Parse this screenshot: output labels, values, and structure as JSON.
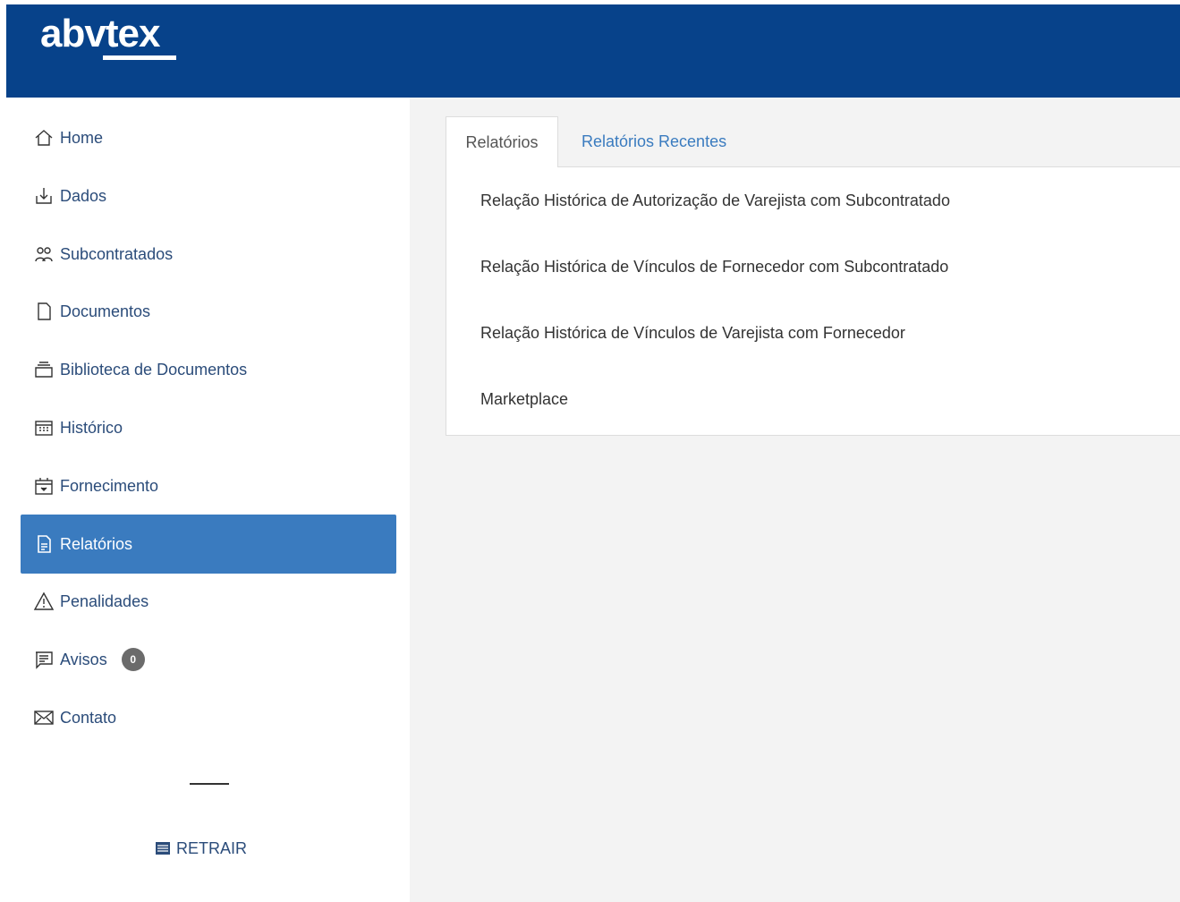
{
  "header": {
    "logo_text": "abvtex",
    "bg_color": "#07428a"
  },
  "sidebar": {
    "items": [
      {
        "label": "Home",
        "icon": "home-icon"
      },
      {
        "label": "Dados",
        "icon": "download-icon"
      },
      {
        "label": "Subcontratados",
        "icon": "users-icon"
      },
      {
        "label": "Documentos",
        "icon": "document-icon"
      },
      {
        "label": "Biblioteca de Documentos",
        "icon": "library-icon"
      },
      {
        "label": "Histórico",
        "icon": "calendar-icon"
      },
      {
        "label": "Fornecimento",
        "icon": "box-icon"
      },
      {
        "label": "Relatórios",
        "icon": "report-icon",
        "active": true
      },
      {
        "label": "Penalidades",
        "icon": "warning-icon"
      },
      {
        "label": "Avisos",
        "icon": "notice-icon",
        "badge": "0"
      },
      {
        "label": "Contato",
        "icon": "mail-icon"
      }
    ],
    "collapse_label": "RETRAIR",
    "active_color": "#3a7bbf"
  },
  "main": {
    "tabs": [
      {
        "label": "Relatórios",
        "active": true
      },
      {
        "label": "Relatórios Recentes",
        "active": false
      }
    ],
    "reports": [
      "Relação Histórica de Autorização de Varejista com Subcontratado",
      "Relação Histórica de Vínculos de Fornecedor com Subcontratado",
      "Relação Histórica de Vínculos de Varejista com Fornecedor",
      "Marketplace"
    ]
  }
}
